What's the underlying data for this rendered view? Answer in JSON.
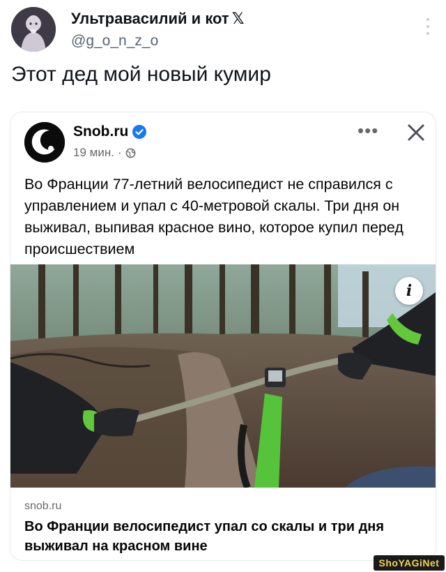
{
  "tweet": {
    "author_name": "Ультравасилий и кот",
    "x_badge": "𝕏",
    "handle": "@g_o_n_z_o",
    "text": "Этот дед мой новый кумир"
  },
  "embedded_post": {
    "page_name": "Snob.ru",
    "time": "19 мин.",
    "separator": "·",
    "more_label": "•••",
    "body": "Во Франции 77-летний велосипедист не справился с управлением и упал с 40-метровой скалы. Три дня он выживал, выпивая красное вино, которое купил перед происшествием",
    "link_domain": "snob.ru",
    "link_title": "Во Франции велосипедист упал со скалы и три дня выживал на красном вине",
    "info_label": "i"
  },
  "watermark": "ShoYAGiNet",
  "colors": {
    "facebook_blue": "#1877f2",
    "handlebar_green": "#6bd33e",
    "text_primary": "#0f1419",
    "text_secondary": "#536471"
  }
}
